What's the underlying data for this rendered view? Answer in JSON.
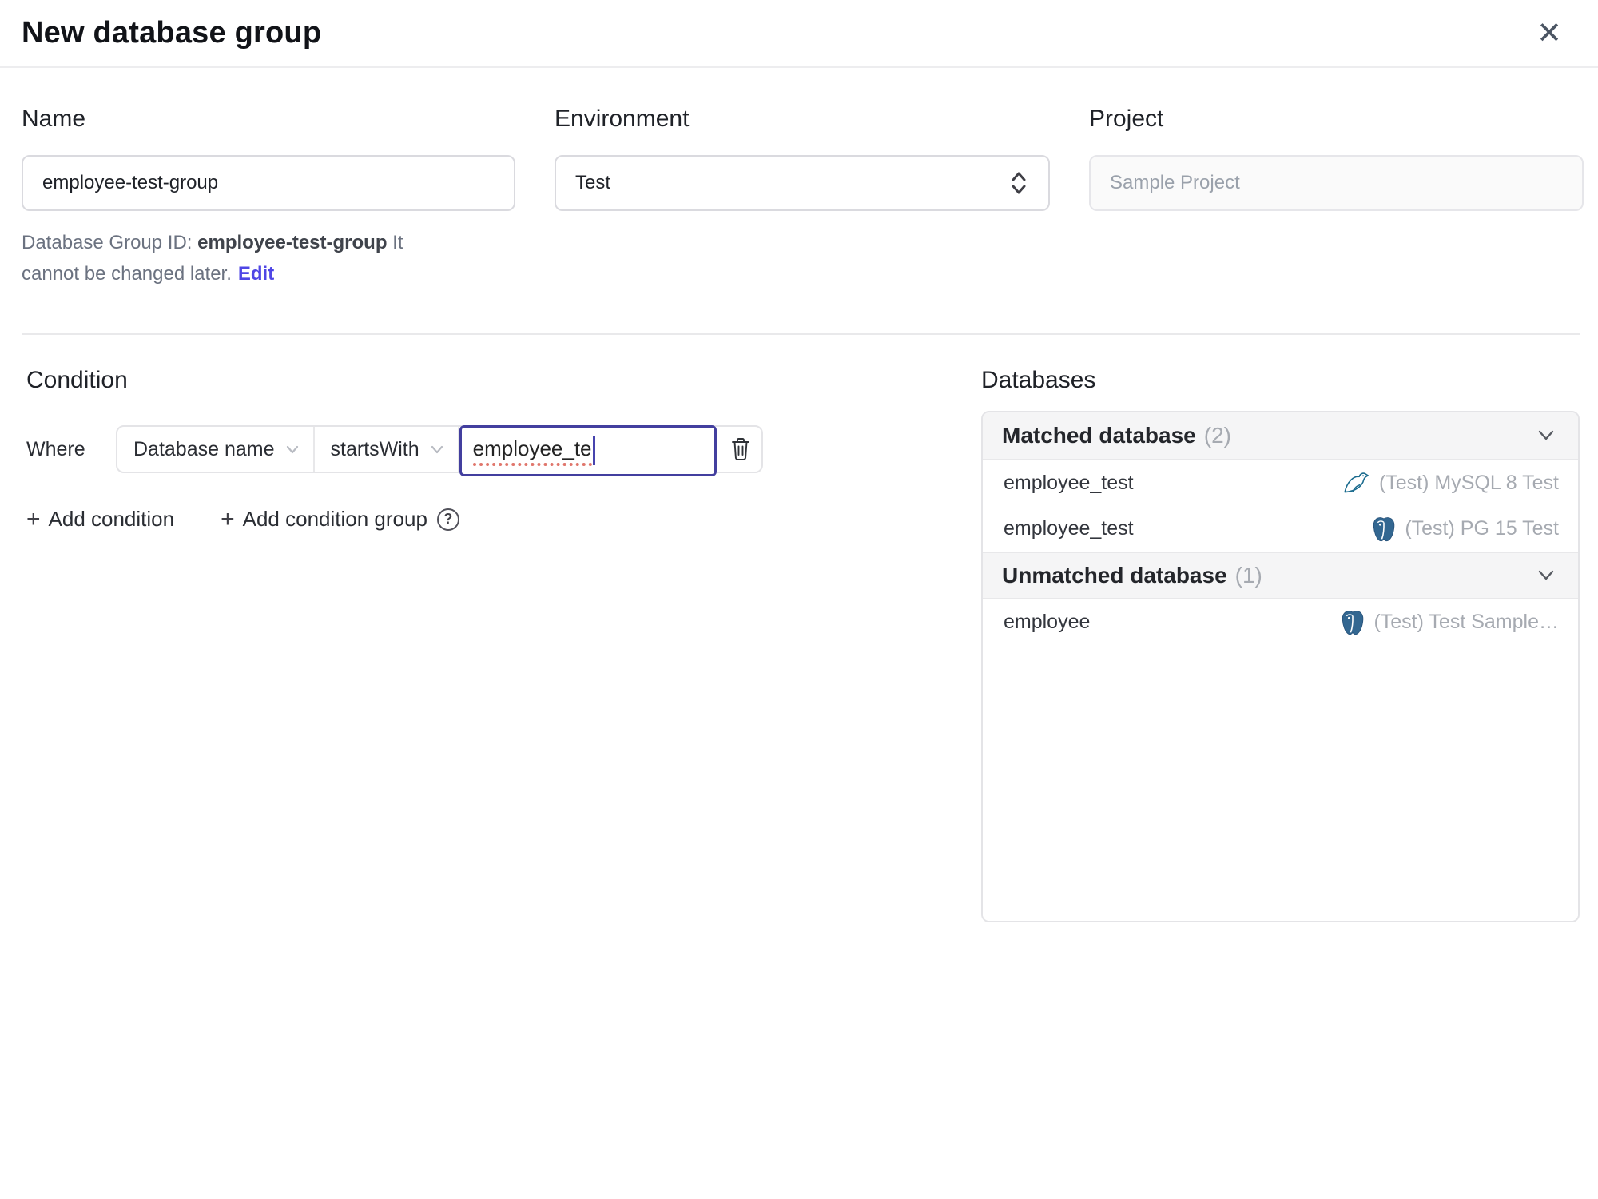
{
  "dialog": {
    "title": "New database group"
  },
  "icons": {
    "close": "✕",
    "plus": "+",
    "help": "?"
  },
  "form": {
    "name": {
      "label": "Name",
      "value": "employee-test-group"
    },
    "environment": {
      "label": "Environment",
      "value": "Test"
    },
    "project": {
      "label": "Project",
      "value": "Sample Project"
    },
    "id_note": {
      "prefix": "Database Group ID:",
      "id": "employee-test-group",
      "suffix": "It cannot be changed later.",
      "edit_label": "Edit"
    }
  },
  "condition": {
    "heading": "Condition",
    "where_label": "Where",
    "factor": "Database name",
    "operator": "startsWith",
    "value": "employee_te",
    "add_condition_label": "Add condition",
    "add_condition_group_label": "Add condition group"
  },
  "databases": {
    "heading": "Databases",
    "sections": [
      {
        "title": "Matched database",
        "count": "(2)",
        "rows": [
          {
            "name": "employee_test",
            "engine": "mysql",
            "instance": "(Test) MySQL 8 Test"
          },
          {
            "name": "employee_test",
            "engine": "postgres",
            "instance": "(Test) PG 15 Test"
          }
        ]
      },
      {
        "title": "Unmatched database",
        "count": "(1)",
        "rows": [
          {
            "name": "employee",
            "engine": "postgres",
            "instance": "(Test) Test Sample…"
          }
        ]
      }
    ]
  },
  "colors": {
    "accent": "#4f46e5",
    "focus_border": "#433f9f",
    "spellcheck_dots": "#e0766c",
    "section_header_bg": "#f5f5f6",
    "border": "#e4e4e7",
    "muted_text": "#a6aab1",
    "postgres_blue": "#336791",
    "mysql_teal": "#1a6b8e"
  }
}
